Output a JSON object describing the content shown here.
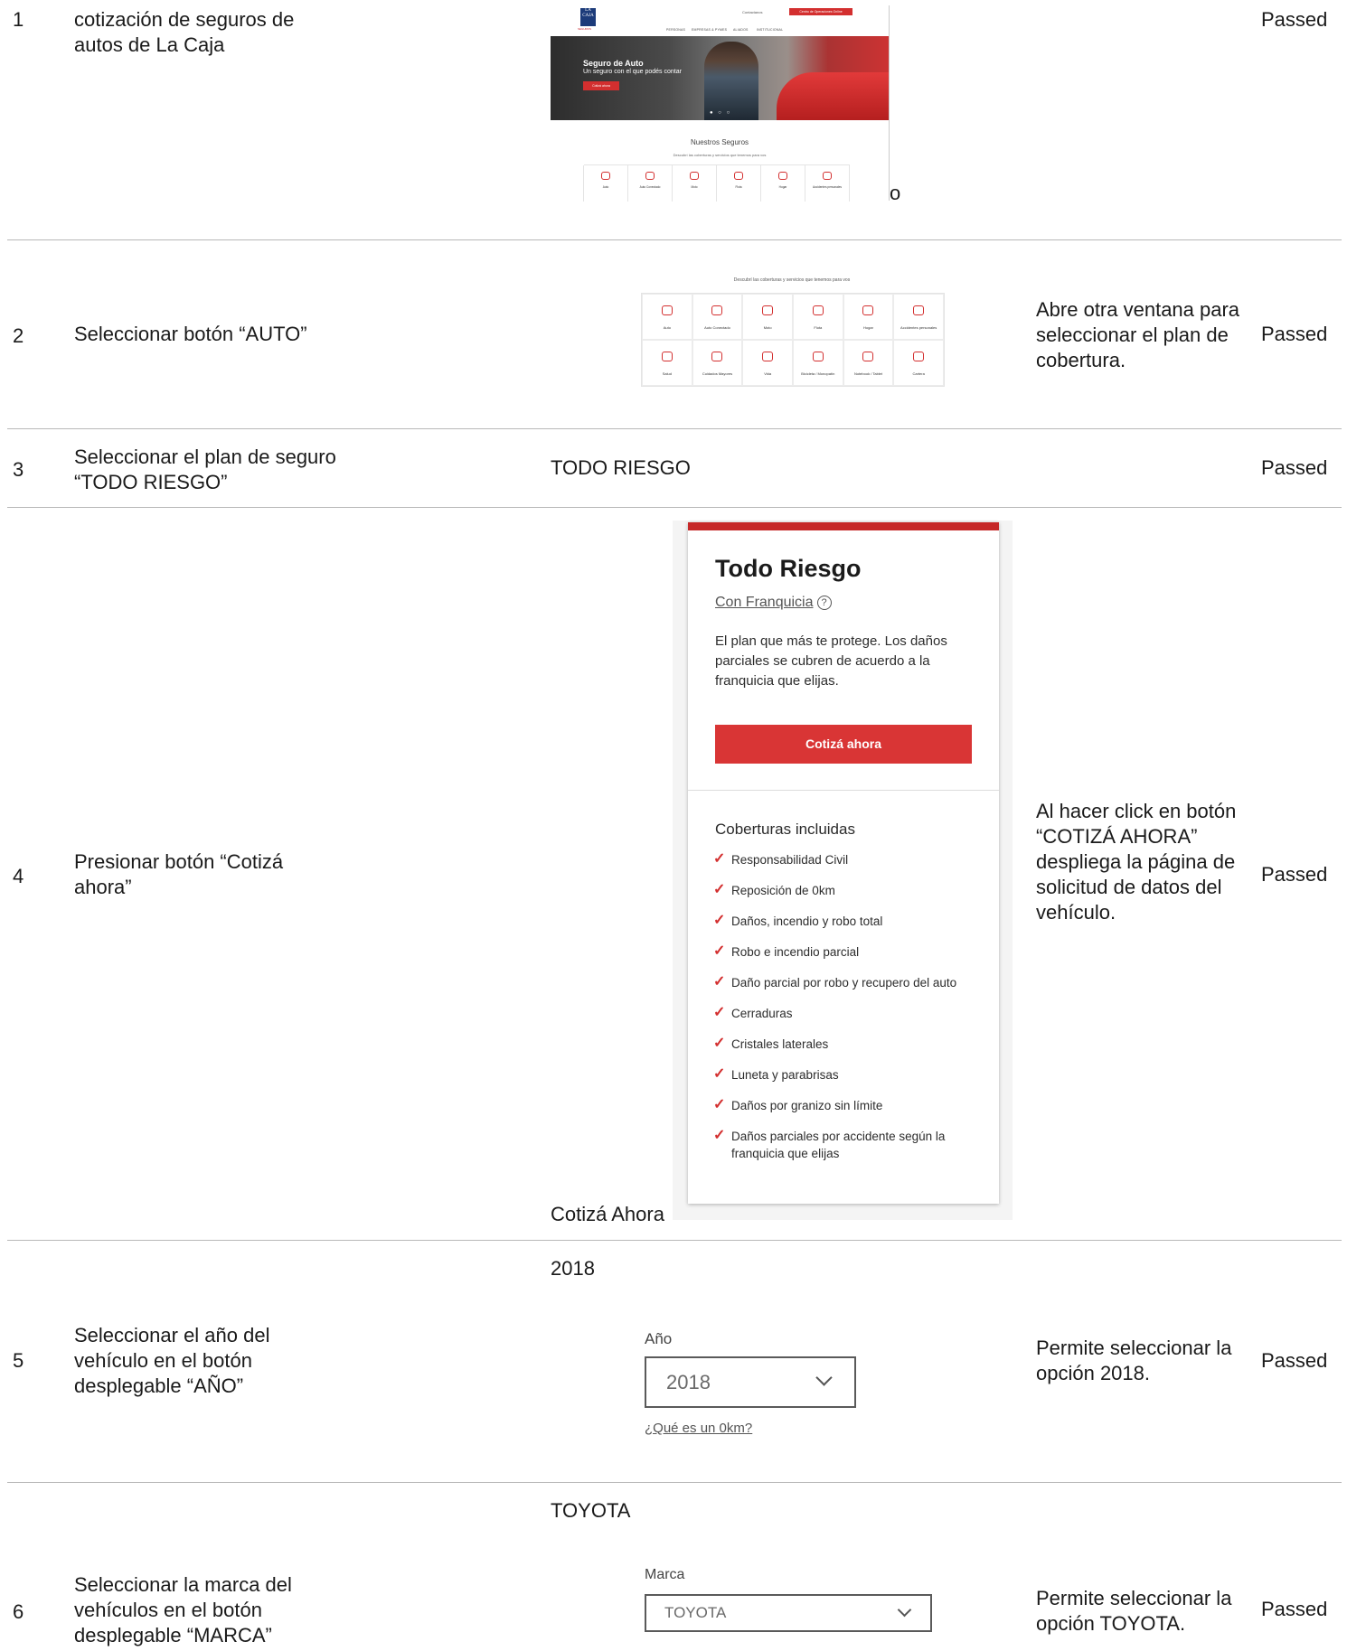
{
  "rows": [
    {
      "num": "1",
      "step": "cotización de seguros de autos de La Caja",
      "data": "",
      "trailing": "o",
      "result": "",
      "status": "Passed"
    },
    {
      "num": "2",
      "step": "Seleccionar botón “AUTO”",
      "data": "",
      "result": "Abre otra ventana para seleccionar el plan de cobertura.",
      "status": "Passed"
    },
    {
      "num": "3",
      "step": "Seleccionar el plan de seguro “TODO RIESGO”",
      "data": "TODO RIESGO",
      "result": "",
      "status": "Passed"
    },
    {
      "num": "4",
      "step": "Presionar botón “Cotizá ahora”",
      "data": "Cotizá Ahora",
      "result": "Al hacer click en botón “COTIZÁ AHORA” despliega la página de solicitud de datos del vehículo.",
      "status": "Passed"
    },
    {
      "num": "5",
      "step": "Seleccionar el año del vehículo en el botón desplegable “AÑO”",
      "data": "2018",
      "result": "Permite seleccionar la opción 2018.",
      "status": "Passed"
    },
    {
      "num": "6",
      "step": "Seleccionar la marca del vehículos en el botón desplegable “MARCA”",
      "data": "TOYOTA",
      "result": "Permite seleccionar la opción TOYOTA.",
      "status": "Passed"
    }
  ],
  "shot_home": {
    "logo_text": "LA CAJA",
    "logo_sub": "SEGUROS",
    "link": "Contactanos",
    "cta": "Centro de Operaciones Online",
    "nav": [
      "PERSONAS",
      "EMPRESAS & PYMES",
      "ALIADOS",
      "INSTITUCIONAL"
    ],
    "hero_title": "Seguro de Auto",
    "hero_subtitle": "Un seguro con el que podés contar",
    "hero_button": "Cotizá ahora",
    "section_title": "Nuestros Seguros",
    "section_desc": "Descubrí las coberturas y servicios que tenemos para vos",
    "products": [
      "Auto",
      "Auto Conectado",
      "Moto",
      "Flota",
      "Hogar",
      "Accidentes personales"
    ]
  },
  "shot_products": {
    "desc": "Descubrí las coberturas y servicios que tenemos para vos",
    "products": [
      "Auto",
      "Auto Conectado",
      "Moto",
      "Flota",
      "Hogar",
      "Accidentes personales",
      "Salud",
      "Cuidados Mayores",
      "Vida",
      "Bicicleta / Monopatín",
      "Notebook / Tablet",
      "Cartera"
    ]
  },
  "plan_card": {
    "title": "Todo Riesgo",
    "subtitle": "Con Franquicia",
    "help_glyph": "?",
    "description": "El plan que más te protege. Los daños parciales se cubren de acuerdo a la franquicia que elijas.",
    "button": "Cotizá ahora",
    "coverage_title": "Coberturas incluidas",
    "coverages": [
      "Responsabilidad Civil",
      "Reposición de 0km",
      "Daños, incendio y robo total",
      "Robo e incendio parcial",
      "Daño parcial por robo y recupero del auto",
      "Cerraduras",
      "Cristales laterales",
      "Luneta y parabrisas",
      "Daños por granizo sin límite",
      "Daños parciales por accidente según la franquicia que elijas"
    ]
  },
  "year_field": {
    "label": "Año",
    "value": "2018",
    "help_link": "¿Qué es un 0km?"
  },
  "brand_field": {
    "label": "Marca",
    "value": "TOYOTA"
  },
  "colors": {
    "accent": "#d32f2f",
    "card_bar": "#c62828"
  }
}
